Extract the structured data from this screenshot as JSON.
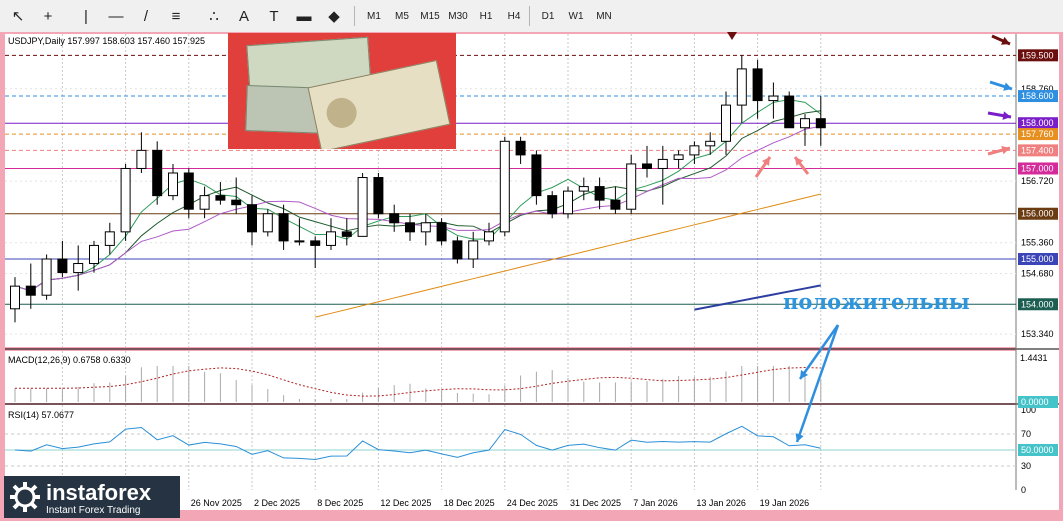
{
  "toolbar": {
    "tools": [
      "cursor-icon",
      "crosshair-icon",
      "vertical-line-icon",
      "horizontal-line-icon",
      "trendline-icon",
      "fibonacci-icon",
      "fibo-fan-icon",
      "text-icon",
      "text-label-icon",
      "rectangle-icon",
      "shapes-icon"
    ],
    "timeframes": [
      "M1",
      "M5",
      "M15",
      "M30",
      "H1",
      "H4",
      "D1",
      "W1",
      "MN"
    ]
  },
  "chart": {
    "header": "USDJPY,Daily  157.997 158.603 157.460 157.925",
    "price_tags": [
      {
        "text": "159.500",
        "value": 159.5,
        "bg": "#6b0e0e"
      },
      {
        "text": "158.760",
        "value": 158.76,
        "bg": ""
      },
      {
        "text": "158.600",
        "value": 158.6,
        "bg": "#2e8fe0"
      },
      {
        "text": "158.000",
        "value": 158.0,
        "bg": "#7a1ec9"
      },
      {
        "text": "157.760",
        "value": 157.76,
        "bg": "#e8901f"
      },
      {
        "text": "157.400",
        "value": 157.4,
        "bg": "#f08080"
      },
      {
        "text": "157.000",
        "value": 157.0,
        "bg": "#d42a9a"
      },
      {
        "text": "156.720",
        "value": 156.72,
        "bg": ""
      },
      {
        "text": "156.000",
        "value": 156.0,
        "bg": "#6b3b12"
      },
      {
        "text": "155.360",
        "value": 155.36,
        "bg": ""
      },
      {
        "text": "155.000",
        "value": 155.0,
        "bg": "#3b45b8"
      },
      {
        "text": "154.680",
        "value": 154.68,
        "bg": ""
      },
      {
        "text": "154.000",
        "value": 154.0,
        "bg": "#1d5e53"
      },
      {
        "text": "153.340",
        "value": 153.34,
        "bg": ""
      }
    ],
    "date_labels": [
      {
        "text": "26 Nov 2025",
        "i": 11
      },
      {
        "text": "2 Dec 2025",
        "i": 15
      },
      {
        "text": "8 Dec 2025",
        "i": 19
      },
      {
        "text": "12 Dec 2025",
        "i": 23
      },
      {
        "text": "18 Dec 2025",
        "i": 27
      },
      {
        "text": "24 Dec 2025",
        "i": 31
      },
      {
        "text": "31 Dec 2025",
        "i": 35
      },
      {
        "text": "7 Jan 2026",
        "i": 39
      },
      {
        "text": "13 Jan 2026",
        "i": 43
      },
      {
        "text": "19 Jan 2026",
        "i": 47
      }
    ],
    "macd": {
      "header": "MACD(12,26,9) 0.6758 0.6330",
      "max_label": "1.4431",
      "zero_label": "0.0000"
    },
    "rsi": {
      "header": "RSI(14) 57.0677",
      "levels": [
        "100",
        "70",
        "50",
        "30",
        "0"
      ],
      "current_tag": "50.0000"
    },
    "annotation": "положительны"
  },
  "logo": {
    "name": "instaforex",
    "tagline": "Instant Forex Trading"
  },
  "chart_data": {
    "type": "candlestick",
    "series": [
      {
        "name": "USDJPY,Daily",
        "ohlc": [
          [
            153.9,
            154.6,
            153.6,
            154.4
          ],
          [
            154.4,
            154.9,
            153.9,
            154.2
          ],
          [
            154.2,
            155.1,
            154.1,
            155.0
          ],
          [
            155.0,
            155.4,
            154.6,
            154.7
          ],
          [
            154.7,
            155.3,
            154.3,
            154.9
          ],
          [
            154.9,
            155.4,
            154.7,
            155.3
          ],
          [
            155.3,
            155.8,
            155.1,
            155.6
          ],
          [
            155.6,
            157.1,
            155.4,
            157.0
          ],
          [
            157.0,
            157.8,
            156.9,
            157.4
          ],
          [
            157.4,
            157.6,
            156.2,
            156.4
          ],
          [
            156.4,
            157.1,
            156.3,
            156.9
          ],
          [
            156.9,
            157.0,
            155.9,
            156.1
          ],
          [
            156.1,
            156.6,
            155.9,
            156.4
          ],
          [
            156.4,
            156.7,
            156.2,
            156.3
          ],
          [
            156.3,
            156.8,
            156.0,
            156.2
          ],
          [
            156.2,
            156.4,
            155.3,
            155.6
          ],
          [
            155.6,
            156.1,
            155.5,
            156.0
          ],
          [
            156.0,
            156.2,
            155.2,
            155.4
          ],
          [
            155.4,
            155.9,
            155.3,
            155.4
          ],
          [
            155.4,
            155.5,
            154.8,
            155.3
          ],
          [
            155.3,
            155.9,
            155.2,
            155.6
          ],
          [
            155.6,
            155.9,
            155.3,
            155.5
          ],
          [
            155.5,
            156.9,
            155.5,
            156.8
          ],
          [
            156.8,
            156.9,
            155.9,
            156.0
          ],
          [
            156.0,
            156.2,
            155.6,
            155.8
          ],
          [
            155.8,
            156.0,
            155.4,
            155.6
          ],
          [
            155.6,
            156.0,
            155.3,
            155.8
          ],
          [
            155.8,
            155.9,
            155.3,
            155.4
          ],
          [
            155.4,
            155.5,
            154.9,
            155.0
          ],
          [
            155.0,
            155.6,
            154.8,
            155.4
          ],
          [
            155.4,
            155.8,
            155.3,
            155.6
          ],
          [
            155.6,
            157.7,
            155.5,
            157.6
          ],
          [
            157.6,
            157.7,
            157.1,
            157.3
          ],
          [
            157.3,
            157.4,
            156.2,
            156.4
          ],
          [
            156.4,
            156.5,
            155.9,
            156.0
          ],
          [
            156.0,
            156.6,
            155.9,
            156.5
          ],
          [
            156.5,
            156.8,
            156.3,
            156.6
          ],
          [
            156.6,
            156.8,
            156.1,
            156.3
          ],
          [
            156.3,
            156.6,
            156.0,
            156.1
          ],
          [
            156.1,
            157.3,
            156.0,
            157.1
          ],
          [
            157.1,
            157.5,
            156.8,
            157.0
          ],
          [
            157.0,
            157.5,
            156.2,
            157.2
          ],
          [
            157.2,
            157.4,
            157.0,
            157.3
          ],
          [
            157.3,
            157.6,
            157.1,
            157.5
          ],
          [
            157.5,
            157.8,
            157.3,
            157.6
          ],
          [
            157.6,
            158.7,
            157.3,
            158.4
          ],
          [
            158.4,
            159.5,
            158.0,
            159.2
          ],
          [
            159.2,
            159.4,
            158.1,
            158.5
          ],
          [
            158.5,
            158.9,
            158.1,
            158.6
          ],
          [
            158.6,
            158.7,
            157.9,
            157.9
          ],
          [
            157.9,
            158.2,
            157.5,
            158.1
          ],
          [
            158.1,
            158.6,
            157.5,
            157.9
          ]
        ]
      }
    ],
    "ylim": [
      153.1,
      159.75
    ],
    "macd_ylim": [
      0,
      1.4431
    ],
    "rsi_ylim": [
      0,
      100
    ]
  }
}
